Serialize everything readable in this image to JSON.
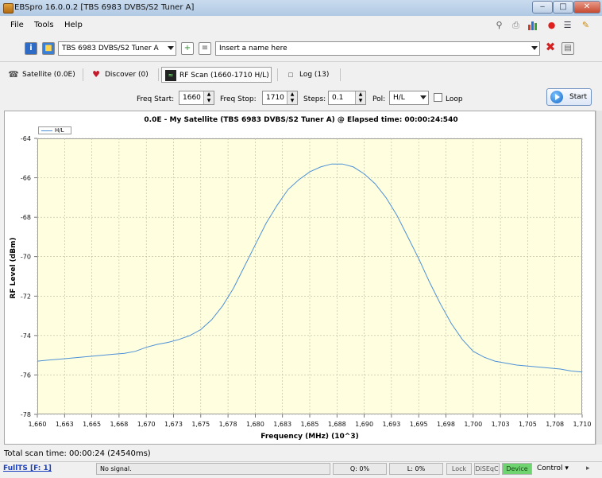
{
  "window": {
    "title": "EBSpro 16.0.0.2 [TBS 6983 DVBS/S2 Tuner A]",
    "controls": {
      "minimize": "‒",
      "maximize": "□",
      "close": "✕"
    }
  },
  "menu": {
    "items": [
      "File",
      "Tools",
      "Help"
    ],
    "right_icons": [
      "search-icon",
      "printer-icon",
      "bar-chart-icon",
      "record-icon",
      "list-icon",
      "tools-icon"
    ]
  },
  "toolbar": {
    "tuner_value": "TBS 6983 DVBS/S2 Tuner A",
    "name_placeholder": "Insert a name here"
  },
  "tabs": [
    {
      "label": "Satellite (0.0E)",
      "icon": "satellite-icon"
    },
    {
      "label": "Discover (0)",
      "icon": "heart-icon"
    },
    {
      "label": "RF Scan (1660-1710 H/L)",
      "icon": "monitor-icon",
      "active": true
    },
    {
      "label": "Log (13)",
      "icon": "log-icon"
    }
  ],
  "scan": {
    "freq_start_label": "Freq Start:",
    "freq_start": "1660",
    "freq_stop_label": "Freq Stop:",
    "freq_stop": "1710",
    "steps_label": "Steps:",
    "steps": "0.1",
    "pol_label": "Pol:",
    "pol": "H/L",
    "loop_label": "Loop",
    "loop_checked": false,
    "start_label": "Start"
  },
  "chart_data": {
    "type": "line",
    "title": "0.0E - My Satellite (TBS 6983 DVBS/S2 Tuner A) @ Elapsed time: 00:00:24:540",
    "xlabel": "Frequency (MHz) (10^3)",
    "ylabel": "RF Level (dBm)",
    "xlim": [
      1660,
      1710
    ],
    "ylim": [
      -78,
      -64
    ],
    "xticks": [
      "1,660",
      "1,663",
      "1,665",
      "1,668",
      "1,670",
      "1,673",
      "1,675",
      "1,678",
      "1,680",
      "1,683",
      "1,685",
      "1,688",
      "1,690",
      "1,693",
      "1,695",
      "1,698",
      "1,700",
      "1,703",
      "1,705",
      "1,708",
      "1,710"
    ],
    "yticks": [
      "-64",
      "-66",
      "-68",
      "-70",
      "-72",
      "-74",
      "-76",
      "-78"
    ],
    "grid": true,
    "legend_position": "top-left",
    "background": "#ffffe0",
    "series": [
      {
        "name": "H/L",
        "color": "#4c8fd6",
        "x": [
          1660,
          1661,
          1662,
          1663,
          1664,
          1665,
          1666,
          1667,
          1668,
          1669,
          1670,
          1671,
          1672,
          1673,
          1674,
          1675,
          1676,
          1677,
          1678,
          1679,
          1680,
          1681,
          1682,
          1683,
          1684,
          1685,
          1686,
          1687,
          1688,
          1689,
          1690,
          1691,
          1692,
          1693,
          1694,
          1695,
          1696,
          1697,
          1698,
          1699,
          1700,
          1701,
          1702,
          1703,
          1704,
          1705,
          1706,
          1707,
          1708,
          1709,
          1710
        ],
        "y": [
          -75.3,
          -75.25,
          -75.2,
          -75.15,
          -75.1,
          -75.05,
          -75.0,
          -74.95,
          -74.9,
          -74.8,
          -74.6,
          -74.45,
          -74.35,
          -74.2,
          -74.0,
          -73.7,
          -73.2,
          -72.5,
          -71.6,
          -70.5,
          -69.4,
          -68.3,
          -67.4,
          -66.6,
          -66.1,
          -65.7,
          -65.45,
          -65.3,
          -65.3,
          -65.45,
          -65.8,
          -66.3,
          -67.0,
          -67.9,
          -69.0,
          -70.1,
          -71.3,
          -72.4,
          -73.4,
          -74.2,
          -74.8,
          -75.1,
          -75.3,
          -75.4,
          -75.5,
          -75.55,
          -75.6,
          -75.65,
          -75.7,
          -75.8,
          -75.85
        ]
      }
    ]
  },
  "status": {
    "total_scan": "Total scan time: 00:00:24 (24540ms)",
    "fullts": "FullTS [F: 1]",
    "signal": "No signal.",
    "q": "Q: 0%",
    "l": "L: 0%",
    "lock": "Lock",
    "diseqc": "DiSEqC",
    "device": "Device",
    "control": "Control ▾"
  }
}
